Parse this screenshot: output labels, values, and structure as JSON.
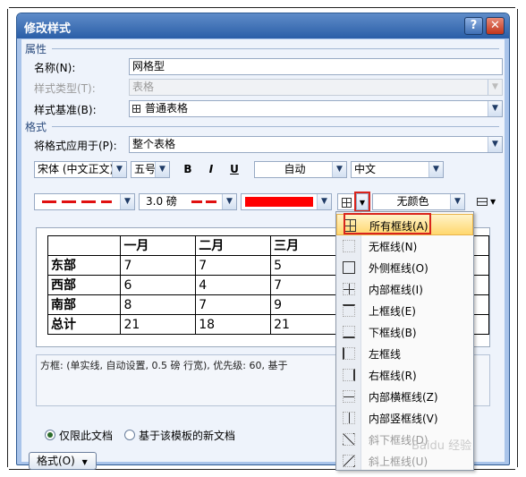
{
  "dialog": {
    "title": "修改样式",
    "help_glyph": "?",
    "close_glyph": "✕"
  },
  "props": {
    "section": "属性",
    "name_label": "名称(N):",
    "name_value": "网格型",
    "type_label": "样式类型(T):",
    "type_value": "表格",
    "base_label": "样式基准(B):",
    "base_value": "普通表格"
  },
  "format": {
    "section": "格式",
    "apply_label": "将格式应用于(P):",
    "apply_value": "整个表格",
    "font": "宋体 (中文正文)",
    "size": "五号",
    "bold": "B",
    "italic": "I",
    "underline": "U",
    "color": "自动",
    "script": "中文",
    "line_weight": "3.0 磅",
    "shading": "无颜色",
    "border_color": "#ff0000"
  },
  "preview": {
    "header": [
      "",
      "一月",
      "二月",
      "三月",
      "",
      ""
    ],
    "rows": [
      [
        "东部",
        "7",
        "7",
        "5",
        "",
        ""
      ],
      [
        "西部",
        "6",
        "4",
        "7",
        "",
        ""
      ],
      [
        "南部",
        "8",
        "7",
        "9",
        "",
        ""
      ],
      [
        "总计",
        "21",
        "18",
        "21",
        "",
        ""
      ]
    ]
  },
  "description": "方框: (单实线, 自动设置, 0.5 磅 行宽), 优先级: 60, 基于",
  "options": {
    "this_doc": "仅限此文档",
    "new_docs": "基于该模板的新文档"
  },
  "format_button": "格式(O)",
  "border_menu": [
    {
      "icon": "all-borders-icon",
      "label": "所有框线(A)"
    },
    {
      "icon": "no-border-icon",
      "label": "无框线(N)"
    },
    {
      "icon": "outside-borders-icon",
      "label": "外侧框线(O)"
    },
    {
      "icon": "inside-borders-icon",
      "label": "内部框线(I)"
    },
    {
      "icon": "top-border-icon",
      "label": "上框线(E)"
    },
    {
      "icon": "bottom-border-icon",
      "label": "下框线(B)"
    },
    {
      "icon": "left-border-icon",
      "label": "左框线"
    },
    {
      "icon": "right-border-icon",
      "label": "右框线(R)"
    },
    {
      "icon": "inside-horizontal-border-icon",
      "label": "内部横框线(Z)"
    },
    {
      "icon": "inside-vertical-border-icon",
      "label": "内部竖框线(V)"
    },
    {
      "icon": "diagonal-down-border-icon",
      "label": "斜下框线(D)"
    },
    {
      "icon": "diagonal-up-border-icon",
      "label": "斜上框线(U)"
    }
  ],
  "watermark": "Baidu 经验",
  "colors": {
    "accent_red": "#d9241c",
    "highlight": "#ffd76e"
  }
}
